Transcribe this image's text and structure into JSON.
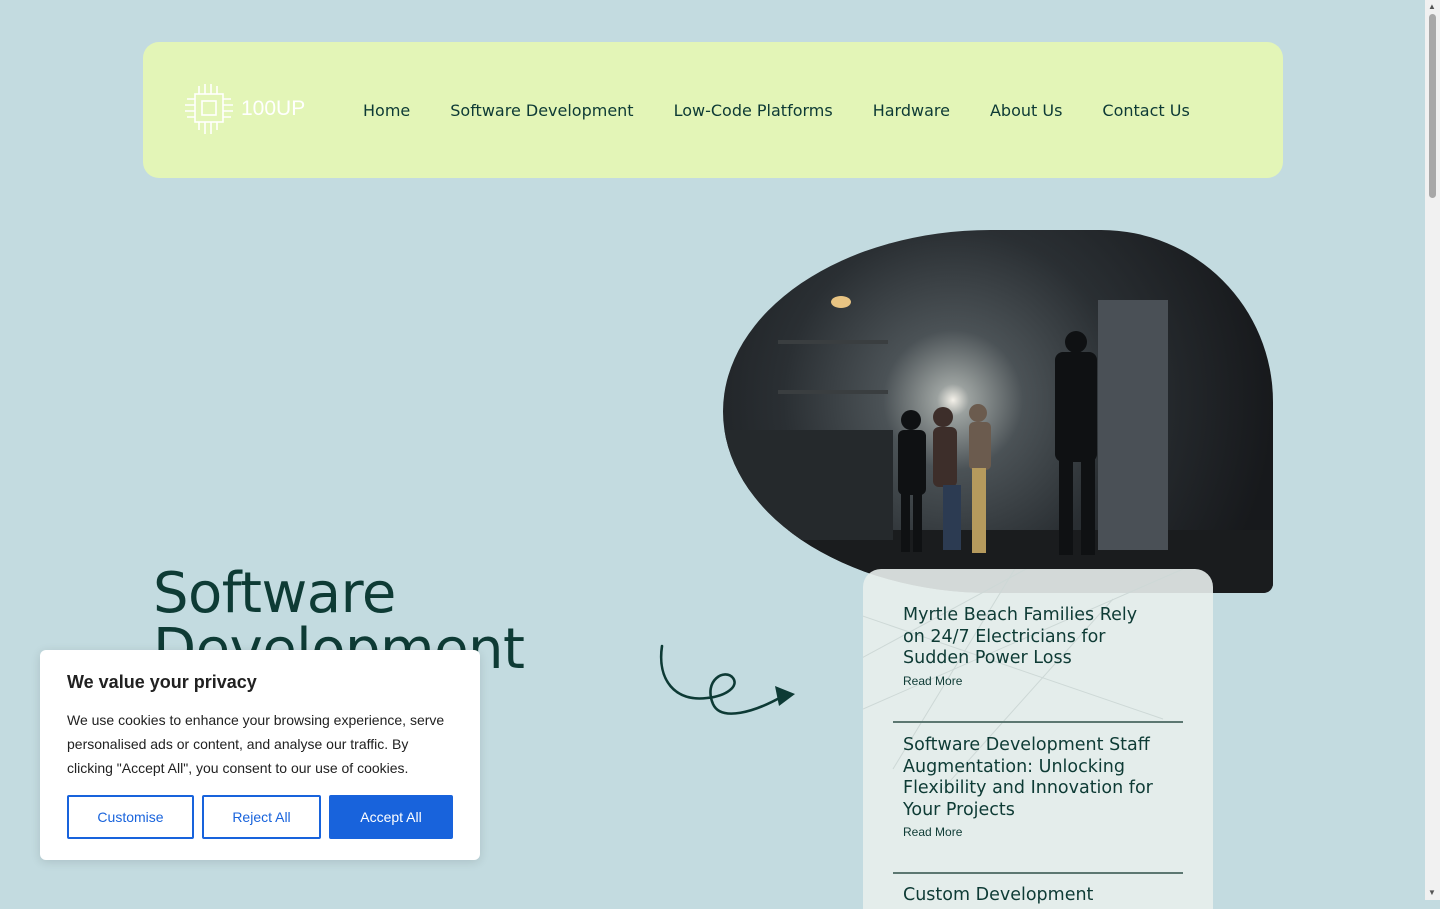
{
  "nav": {
    "logo_text": "100UP",
    "items": [
      {
        "label": "Home"
      },
      {
        "label": "Software Development"
      },
      {
        "label": "Low-Code Platforms"
      },
      {
        "label": "Hardware"
      },
      {
        "label": "About Us"
      },
      {
        "label": "Contact Us"
      }
    ]
  },
  "hero": {
    "title_line1": "Software",
    "title_line2": "Development"
  },
  "posts": [
    {
      "title": "Myrtle Beach Families Rely on 24/7 Electricians for Sudden Power Loss",
      "link": "Read More"
    },
    {
      "title": "Software Development Staff Augmentation: Unlocking Flexibility and Innovation for Your Projects",
      "link": "Read More"
    },
    {
      "title": "Custom Development",
      "link": ""
    }
  ],
  "cookie": {
    "title": "We value your privacy",
    "body": "We use cookies to enhance your browsing experience, serve personalised ads or content, and analyse our traffic. By clicking \"Accept All\", you consent to our use of cookies.",
    "customise": "Customise",
    "reject": "Reject All",
    "accept": "Accept All"
  },
  "colors": {
    "background": "#c3dbe0",
    "header": "#e3f5b7",
    "text": "#0d3a35",
    "accent": "#1863dc"
  }
}
